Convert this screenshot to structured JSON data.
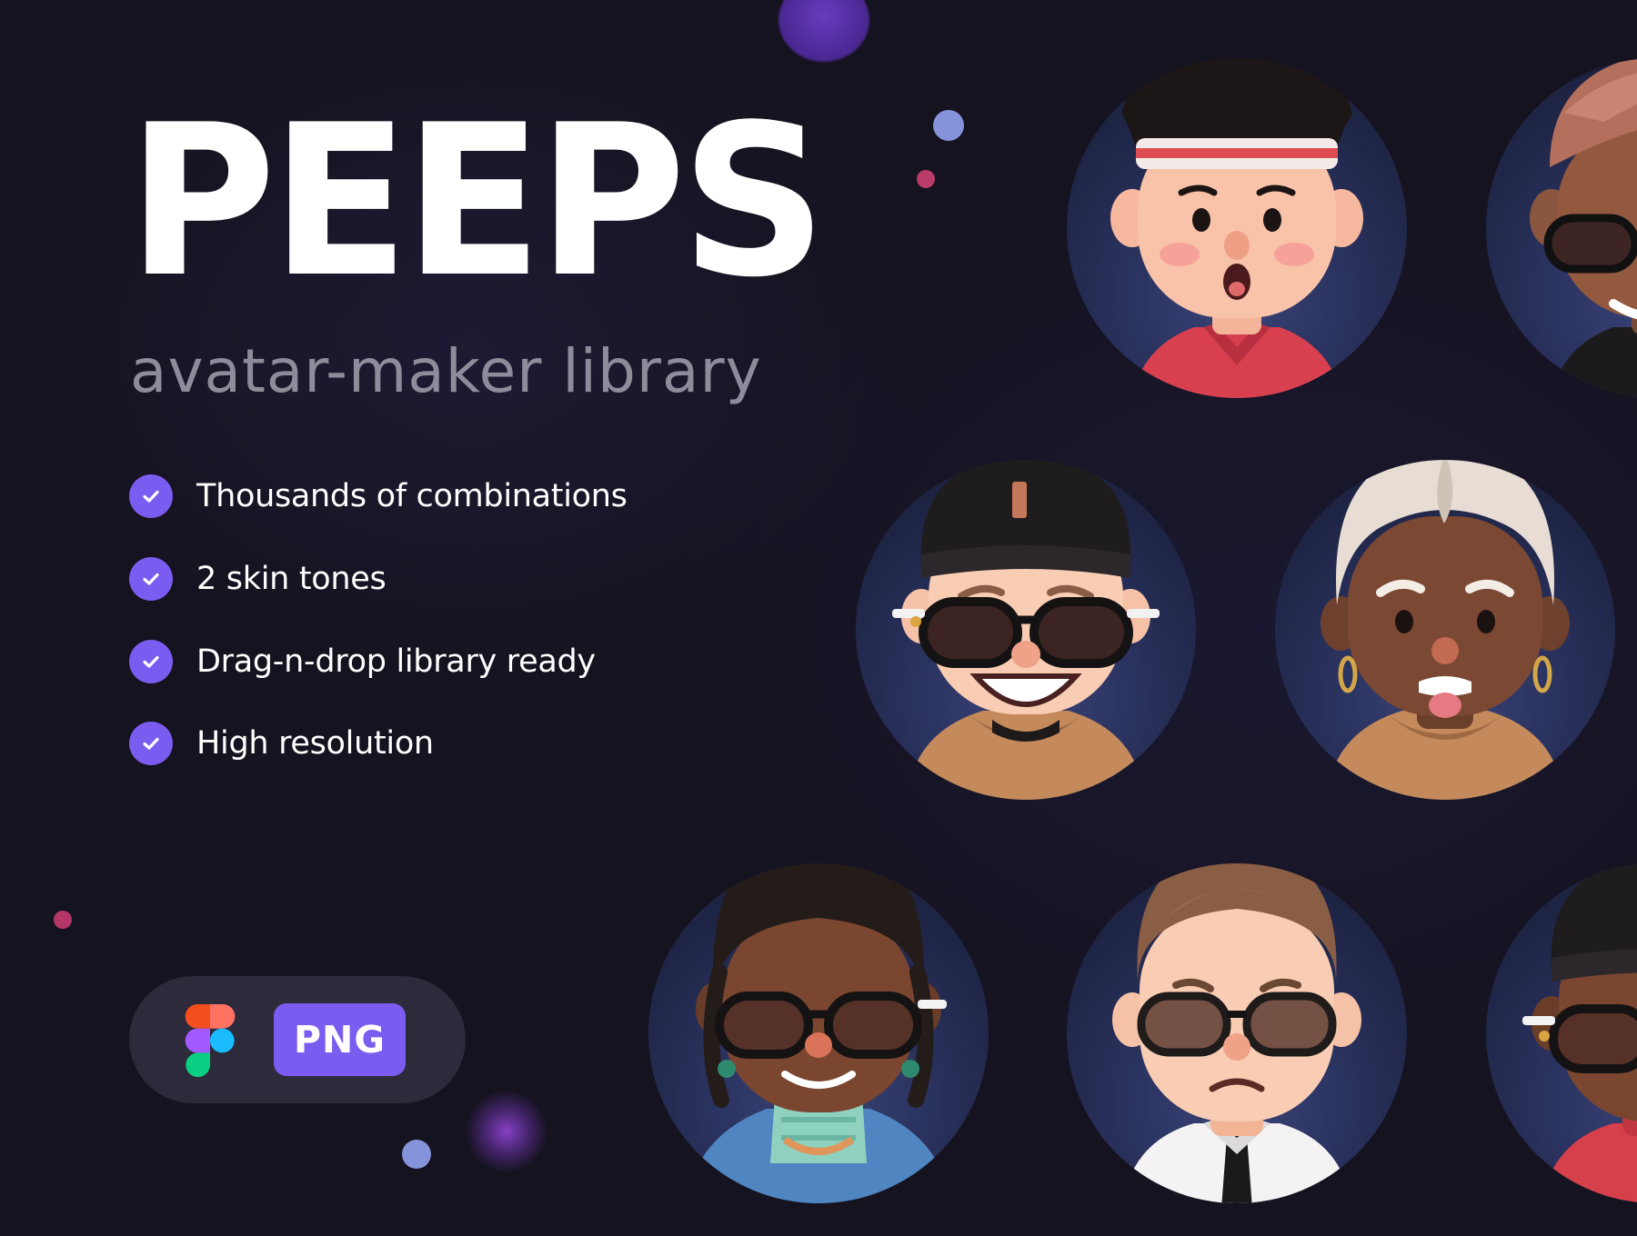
{
  "hero": {
    "title": "PEEPS",
    "subtitle": "avatar-maker library"
  },
  "features": [
    {
      "label": "Thousands of combinations",
      "icon": "check-circle-icon"
    },
    {
      "label": "2 skin tones",
      "icon": "check-circle-icon"
    },
    {
      "label": "Drag-n-drop library ready",
      "icon": "check-circle-icon"
    },
    {
      "label": "High resolution",
      "icon": "check-circle-icon"
    }
  ],
  "formats": {
    "tool_icon": "figma-logo-icon",
    "badge_label": "PNG"
  },
  "colors": {
    "background": "#15131f",
    "accent": "#7b5cf0",
    "subtitle": "#8e8c9a",
    "avatar_circle": "#2b3360",
    "pill": "#2c2a3b"
  },
  "avatars": [
    {
      "name": "avatar-headband-red-polo"
    },
    {
      "name": "avatar-pink-hair-glasses"
    },
    {
      "name": "avatar-beanie-sunglasses-hoodie"
    },
    {
      "name": "avatar-white-hair-hoodie"
    },
    {
      "name": "avatar-braids-glasses-blazer"
    },
    {
      "name": "avatar-short-hair-glasses-tie"
    },
    {
      "name": "avatar-beanie-glasses-red-sweater"
    }
  ]
}
